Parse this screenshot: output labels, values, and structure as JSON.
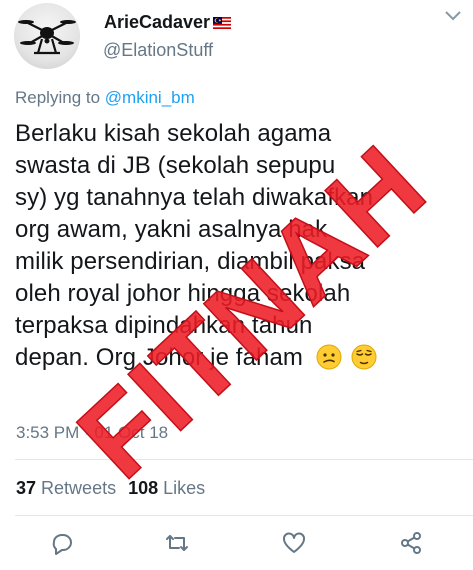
{
  "tweet": {
    "display_name": "ArieCadaver",
    "handle": "@ElationStuff",
    "replying_prefix": "Replying to ",
    "replying_mention": "@mkini_bm",
    "text_lines": [
      "Berlaku kisah sekolah agama",
      "swasta di JB (sekolah sepupu",
      "sy) yg tanahnya telah diwakafkan",
      "org awam, yakni asalnya hak",
      "milik persendirian, diambil paksa",
      "oleh royal johor hingga sekolah",
      "terpaksa dipindahkan tahun",
      "depan. Org Johor je faham"
    ],
    "emoji_icons": [
      "confused-face-icon",
      "relieved-face-icon"
    ],
    "time": "3:53 PM",
    "date_separator": " · ",
    "date": "01 Oct 18"
  },
  "stats": {
    "retweets_count": "37",
    "retweets_label": "Retweets",
    "likes_count": "108",
    "likes_label": "Likes"
  },
  "actions": [
    "reply-icon",
    "retweet-icon",
    "like-icon",
    "share-icon"
  ],
  "stamp": {
    "text": "FITNAH",
    "color": "#ee1c25"
  },
  "colors": {
    "text": "#14171a",
    "secondary": "#657786",
    "link": "#1da1f2",
    "divider": "#e1e8ed"
  }
}
